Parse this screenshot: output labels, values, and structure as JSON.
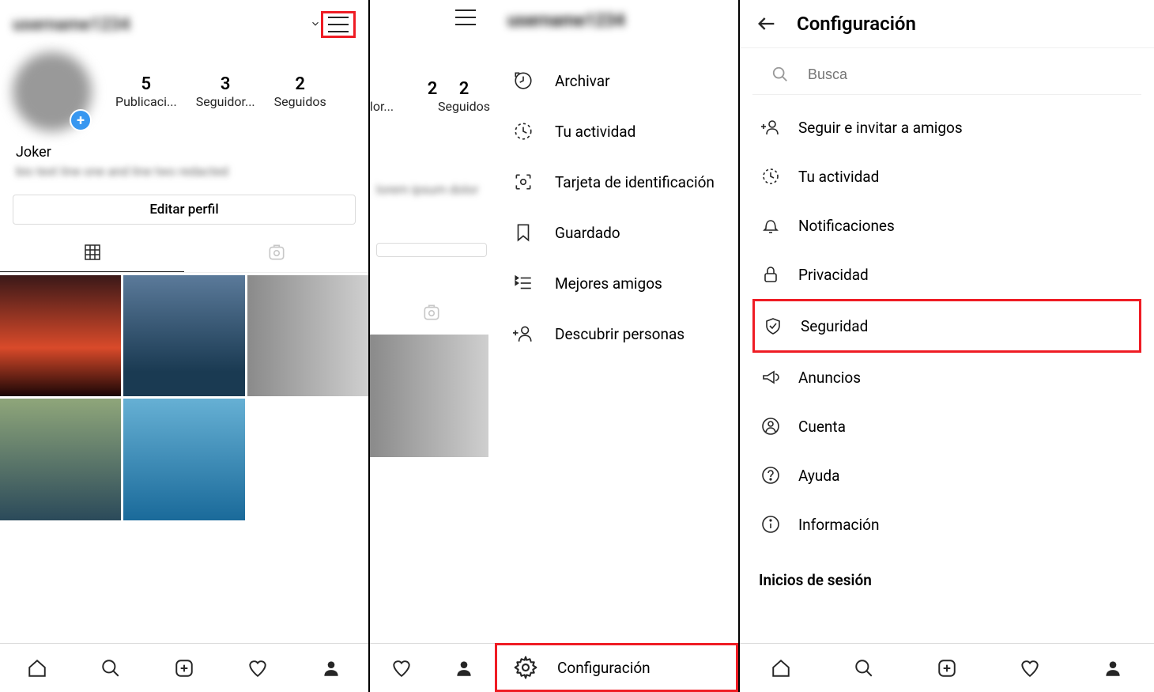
{
  "pane1": {
    "username": "username1234",
    "stats": [
      {
        "num": "5",
        "label": "Publicaci..."
      },
      {
        "num": "3",
        "label": "Seguidor..."
      },
      {
        "num": "2",
        "label": "Seguidos"
      }
    ],
    "bio_name": "Joker",
    "bio_text": "bio text line one and line two redacted",
    "edit_button": "Editar perfil"
  },
  "pane2": {
    "username": "username1234",
    "partial_stats": [
      {
        "num": "2",
        "label": "Seguidos"
      }
    ],
    "drawer": [
      {
        "key": "archive",
        "label": "Archivar"
      },
      {
        "key": "activity",
        "label": "Tu actividad"
      },
      {
        "key": "nametag",
        "label": "Tarjeta de identificación"
      },
      {
        "key": "saved",
        "label": "Guardado"
      },
      {
        "key": "close-friends",
        "label": "Mejores amigos"
      },
      {
        "key": "discover",
        "label": "Descubrir personas"
      }
    ],
    "config_label": "Configuración"
  },
  "pane3": {
    "title": "Configuración",
    "search_placeholder": "Busca",
    "items": [
      {
        "key": "follow-invite",
        "label": "Seguir e invitar a amigos"
      },
      {
        "key": "your-activity",
        "label": "Tu actividad"
      },
      {
        "key": "notifications",
        "label": "Notificaciones"
      },
      {
        "key": "privacy",
        "label": "Privacidad"
      },
      {
        "key": "security",
        "label": "Seguridad",
        "highlighted": true
      },
      {
        "key": "ads",
        "label": "Anuncios"
      },
      {
        "key": "account",
        "label": "Cuenta"
      },
      {
        "key": "help",
        "label": "Ayuda"
      },
      {
        "key": "about",
        "label": "Información"
      }
    ],
    "section_header": "Inicios de sesión"
  }
}
